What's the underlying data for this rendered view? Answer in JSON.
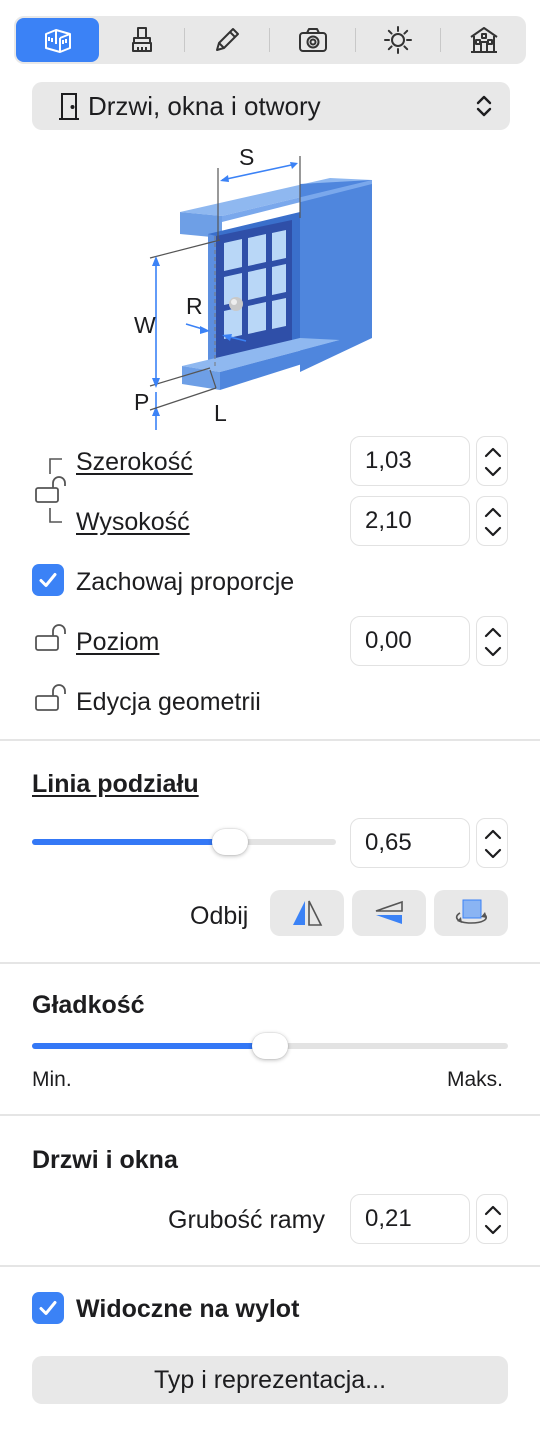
{
  "toolbar": {
    "tabs": [
      {
        "icon": "ruler-building-icon",
        "active": true
      },
      {
        "icon": "brush-icon",
        "active": false
      },
      {
        "icon": "pencil-icon",
        "active": false
      },
      {
        "icon": "camera-icon",
        "active": false
      },
      {
        "icon": "sun-icon",
        "active": false
      },
      {
        "icon": "house-icon",
        "active": false
      }
    ]
  },
  "category": {
    "icon": "door-icon",
    "label": "Drzwi, okna i otwory"
  },
  "diagram": {
    "labels": {
      "s": "S",
      "w": "W",
      "r": "R",
      "p": "P",
      "l": "L"
    }
  },
  "dimensions": {
    "width": {
      "label": "Szerokość",
      "value": "1,03"
    },
    "height": {
      "label": "Wysokość",
      "value": "2,10"
    },
    "keep_proportions": {
      "label": "Zachowaj proporcje",
      "checked": true
    },
    "level": {
      "label": "Poziom",
      "value": "0,00"
    },
    "edit_geometry": {
      "label": "Edycja geometrii"
    }
  },
  "split_line": {
    "heading": "Linia podziału",
    "slider_value": 0.65,
    "value": "0,65",
    "flip_label": "Odbij",
    "flip_buttons": [
      "flip-horizontal-icon",
      "flip-vertical-icon",
      "rotate-plane-icon"
    ]
  },
  "smoothness": {
    "heading": "Gładkość",
    "slider_value": 0.5,
    "min_label": "Min.",
    "max_label": "Maks."
  },
  "doors_windows": {
    "heading": "Drzwi i okna",
    "frame_thickness_label": "Grubość ramy",
    "frame_thickness_value": "0,21"
  },
  "visible_through": {
    "label": "Widoczne na wylot",
    "checked": true
  },
  "type_button": {
    "label": "Typ i reprezentacja..."
  },
  "colors": {
    "accent": "#3b82f6",
    "panel": "#e8e8e8"
  }
}
